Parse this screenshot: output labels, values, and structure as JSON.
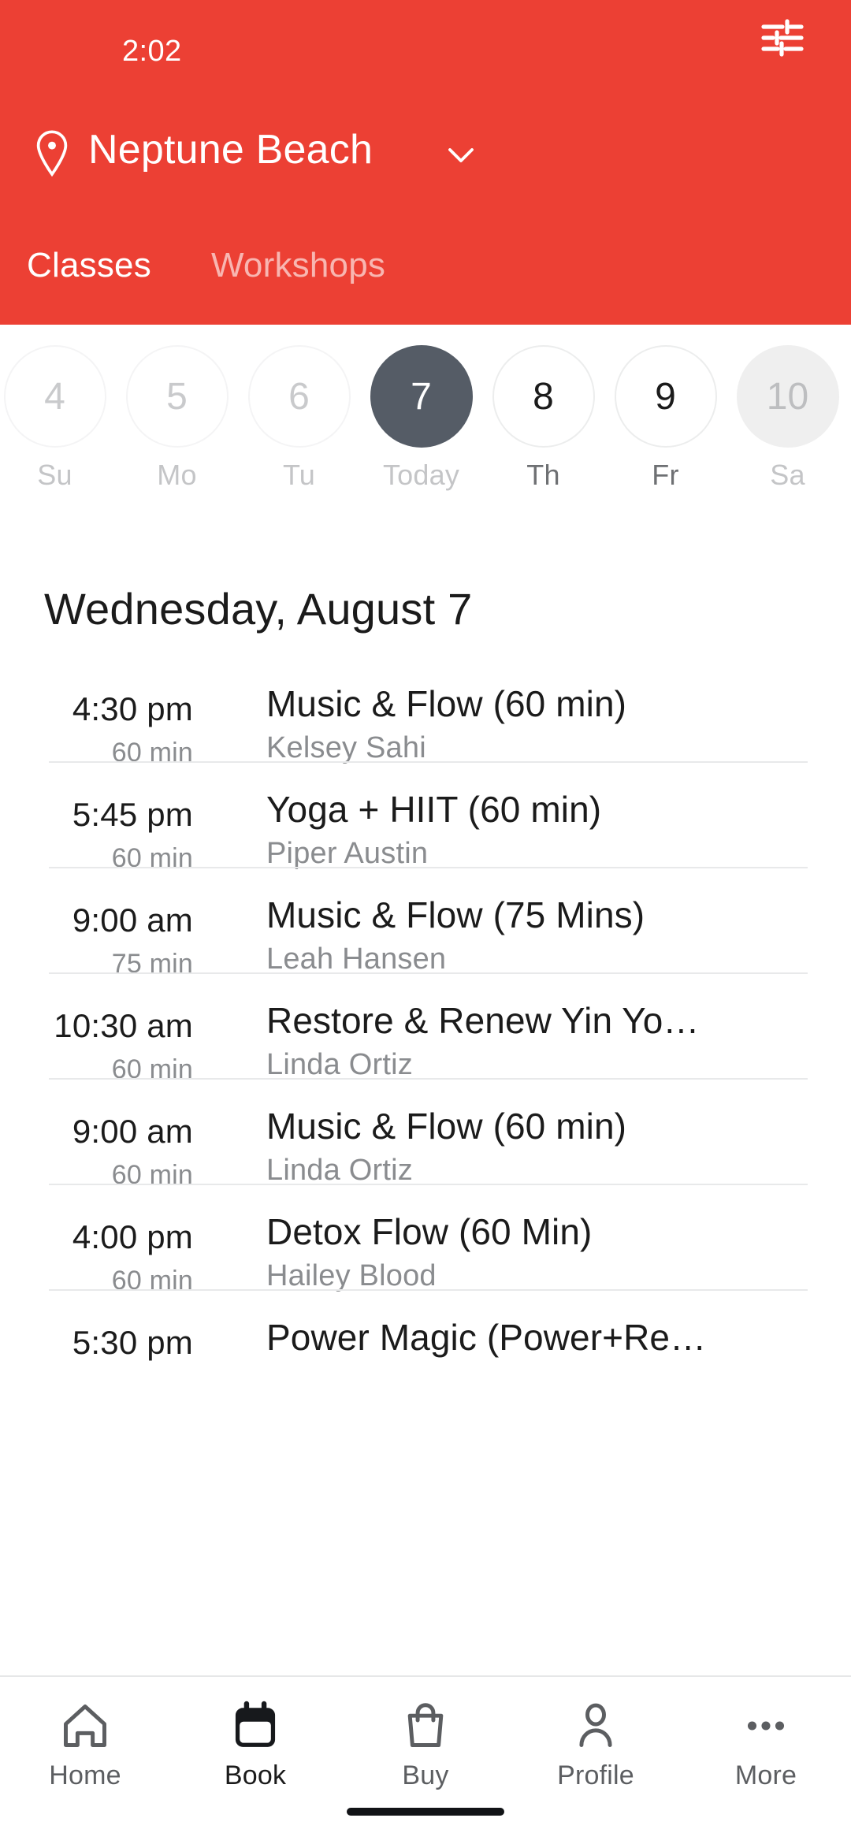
{
  "status_bar": {
    "time": "2:02"
  },
  "header": {
    "location": "Neptune Beach",
    "pin_icon": "location-pin-icon",
    "chevron_icon": "chevron-down-icon",
    "filter_icon": "tune-filter-icon",
    "background_color": "#ec4034",
    "tabs": [
      {
        "label": "Classes",
        "active": true
      },
      {
        "label": "Workshops",
        "active": false
      }
    ]
  },
  "date_strip": {
    "days": [
      {
        "number": "4",
        "dow": "Su",
        "state": "past"
      },
      {
        "number": "5",
        "dow": "Mo",
        "state": "past"
      },
      {
        "number": "6",
        "dow": "Tu",
        "state": "past"
      },
      {
        "number": "7",
        "dow": "Today",
        "state": "selected"
      },
      {
        "number": "8",
        "dow": "Th",
        "state": "default"
      },
      {
        "number": "9",
        "dow": "Fr",
        "state": "default"
      },
      {
        "number": "10",
        "dow": "Sa",
        "state": "shaded"
      }
    ],
    "selected_color": "#555c66"
  },
  "schedule": {
    "day_title": "Wednesday, August 7",
    "items": [
      {
        "time": "4:30 pm",
        "duration": "60 min",
        "title": "Music & Flow (60 min)",
        "instructor": "Kelsey Sahi"
      },
      {
        "time": "5:45 pm",
        "duration": "60 min",
        "title": "Yoga + HIIT (60 min)",
        "instructor": "Piper Austin"
      },
      {
        "time": "9:00 am",
        "duration": "75 min",
        "title": "Music & Flow (75 Mins)",
        "instructor": "Leah Hansen"
      },
      {
        "time": "10:30 am",
        "duration": "60 min",
        "title": "Restore & Renew Yin Yo…",
        "instructor": "Linda Ortiz"
      },
      {
        "time": "9:00 am",
        "duration": "60 min",
        "title": "Music & Flow (60 min)",
        "instructor": "Linda Ortiz"
      },
      {
        "time": "4:00 pm",
        "duration": "60 min",
        "title": "Detox Flow (60 Min)",
        "instructor": "Hailey Blood"
      },
      {
        "time": "5:30 pm",
        "duration": "",
        "title": "Power Magic (Power+Re…",
        "instructor": ""
      }
    ]
  },
  "bottom_nav": {
    "items": [
      {
        "label": "Home",
        "icon": "home-icon",
        "active": false
      },
      {
        "label": "Book",
        "icon": "calendar-icon",
        "active": true
      },
      {
        "label": "Buy",
        "icon": "bag-icon",
        "active": false
      },
      {
        "label": "Profile",
        "icon": "person-icon",
        "active": false
      },
      {
        "label": "More",
        "icon": "ellipsis-icon",
        "active": false
      }
    ]
  }
}
